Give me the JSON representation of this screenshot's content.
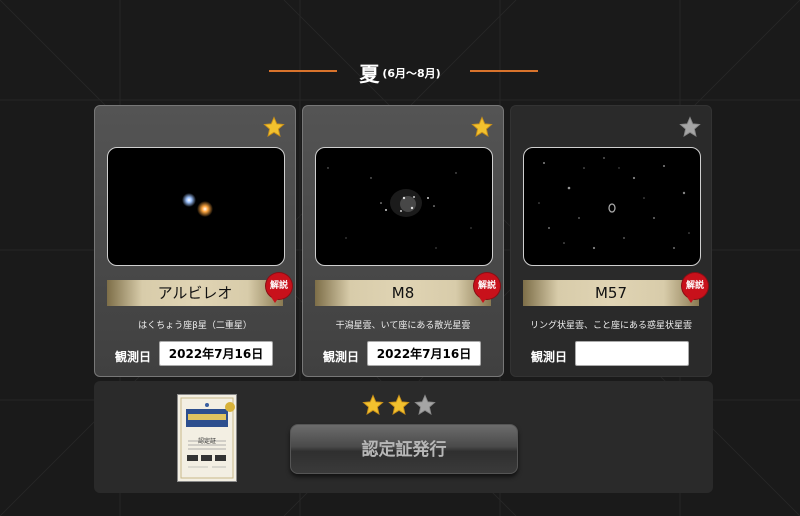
{
  "heading": {
    "season": "夏",
    "months": "(6月〜8月)"
  },
  "cards": [
    {
      "name": "アルビレオ",
      "description": "はくちょう座β星（二重星）",
      "badge": "解説",
      "date_label": "観測日",
      "date_value": "2022年7月16日",
      "star": "filled-star-icon",
      "observed": true
    },
    {
      "name": "M8",
      "description": "干潟星雲、いて座にある散光星雲",
      "badge": "解説",
      "date_label": "観測日",
      "date_value": "2022年7月16日",
      "star": "filled-star-icon",
      "observed": true
    },
    {
      "name": "M57",
      "description": "リング状星雲、こと座にある惑星状星雲",
      "badge": "解説",
      "date_label": "観測日",
      "date_value": "",
      "star": "empty-star-icon",
      "observed": false
    }
  ],
  "bottom": {
    "certificate_title": "認定証",
    "rating": {
      "filled": 2,
      "total": 3
    },
    "issue_button_label": "認定証発行"
  },
  "colors": {
    "accent_line": "#d8732c",
    "star_gold": "#f2c12e",
    "star_grey": "#a5a5a5",
    "badge_red": "#c8111b"
  }
}
